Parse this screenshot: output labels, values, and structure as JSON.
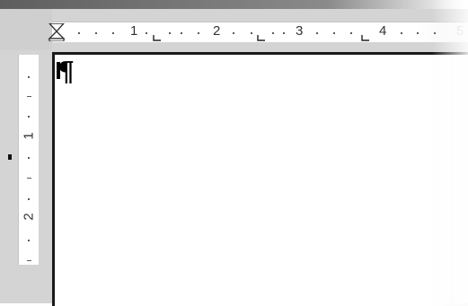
{
  "ruler": {
    "horizontal_numbers": [
      "1",
      "2",
      "3",
      "4",
      "5"
    ],
    "vertical_numbers": [
      "1",
      "2"
    ]
  },
  "document": {
    "paragraph_mark": "¶"
  },
  "icons": {
    "indent_marker": "hourglass-indent-icon",
    "tab_stop": "left-tab-stop-icon"
  },
  "colors": {
    "workspace": "#d4d4d4",
    "page": "#ffffff",
    "page_border": "#1a1a1a"
  }
}
